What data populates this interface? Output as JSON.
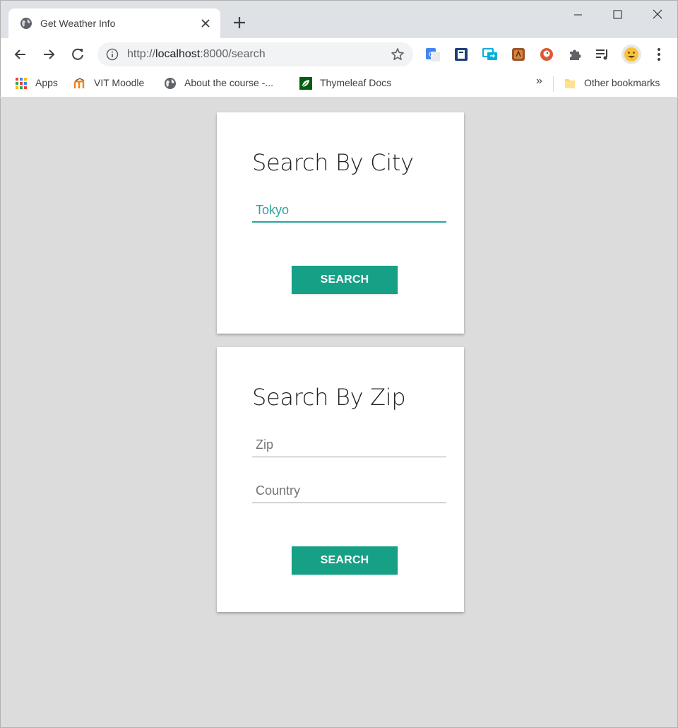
{
  "browser": {
    "tab": {
      "title": "Get Weather Info"
    },
    "address_bar": {
      "scheme": "http://",
      "host": "localhost",
      "path": ":8000/search"
    },
    "bookmarks": {
      "apps_label": "Apps",
      "moodle_label": "VIT Moodle",
      "course_label": "About the course -...",
      "thymeleaf_label": "Thymeleaf Docs",
      "overflow": "»",
      "other_label": "Other bookmarks"
    }
  },
  "page": {
    "city_card": {
      "title": "Search By City",
      "city_value": "Tokyo",
      "button_label": "Search"
    },
    "zip_card": {
      "title": "Search By Zip",
      "zip_placeholder": "Zip",
      "country_placeholder": "Country",
      "button_label": "Search"
    }
  },
  "colors": {
    "accent": "#26a69a",
    "button": "#16a085",
    "page_background": "#dcdcdc"
  }
}
